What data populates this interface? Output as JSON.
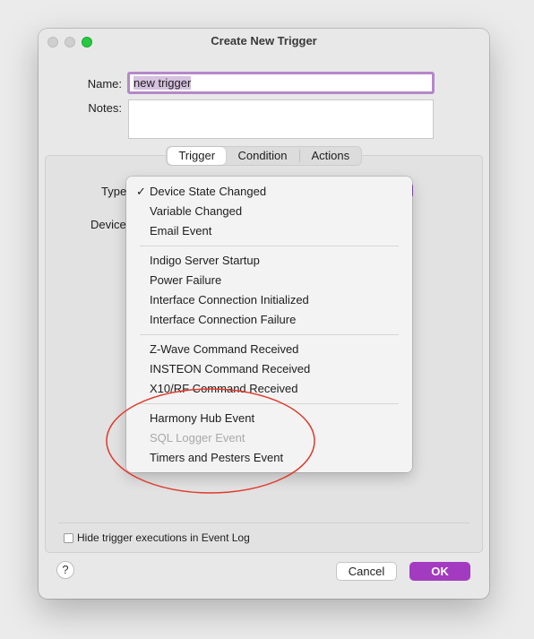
{
  "window": {
    "title": "Create New Trigger"
  },
  "form": {
    "name_label": "Name:",
    "name_value": "new trigger",
    "notes_label": "Notes:",
    "notes_value": ""
  },
  "tabs": [
    {
      "label": "Trigger",
      "active": true
    },
    {
      "label": "Condition",
      "active": false
    },
    {
      "label": "Actions",
      "active": false
    }
  ],
  "trigger": {
    "type_label": "Type",
    "device_label": "Device"
  },
  "type_menu": {
    "selected": "Device State Changed",
    "groups": [
      [
        {
          "label": "Device State Changed",
          "checked": true,
          "disabled": false
        },
        {
          "label": "Variable Changed",
          "checked": false,
          "disabled": false
        },
        {
          "label": "Email Event",
          "checked": false,
          "disabled": false
        }
      ],
      [
        {
          "label": "Indigo Server Startup",
          "checked": false,
          "disabled": false
        },
        {
          "label": "Power Failure",
          "checked": false,
          "disabled": false
        },
        {
          "label": "Interface Connection Initialized",
          "checked": false,
          "disabled": false
        },
        {
          "label": "Interface Connection Failure",
          "checked": false,
          "disabled": false
        }
      ],
      [
        {
          "label": "Z-Wave Command Received",
          "checked": false,
          "disabled": false
        },
        {
          "label": "INSTEON Command Received",
          "checked": false,
          "disabled": false
        },
        {
          "label": "X10/RF Command Received",
          "checked": false,
          "disabled": false
        }
      ],
      [
        {
          "label": "Harmony Hub Event",
          "checked": false,
          "disabled": false
        },
        {
          "label": "SQL Logger Event",
          "checked": false,
          "disabled": true
        },
        {
          "label": "Timers and Pesters Event",
          "checked": false,
          "disabled": false
        }
      ]
    ]
  },
  "options": {
    "hide_executions_label": "Hide trigger executions in Event Log",
    "hide_executions_checked": false
  },
  "buttons": {
    "help": "?",
    "cancel": "Cancel",
    "ok": "OK"
  },
  "colors": {
    "accent": "#a33bc0",
    "annotation": "#e0392b",
    "zoom_light": "#28c840"
  }
}
